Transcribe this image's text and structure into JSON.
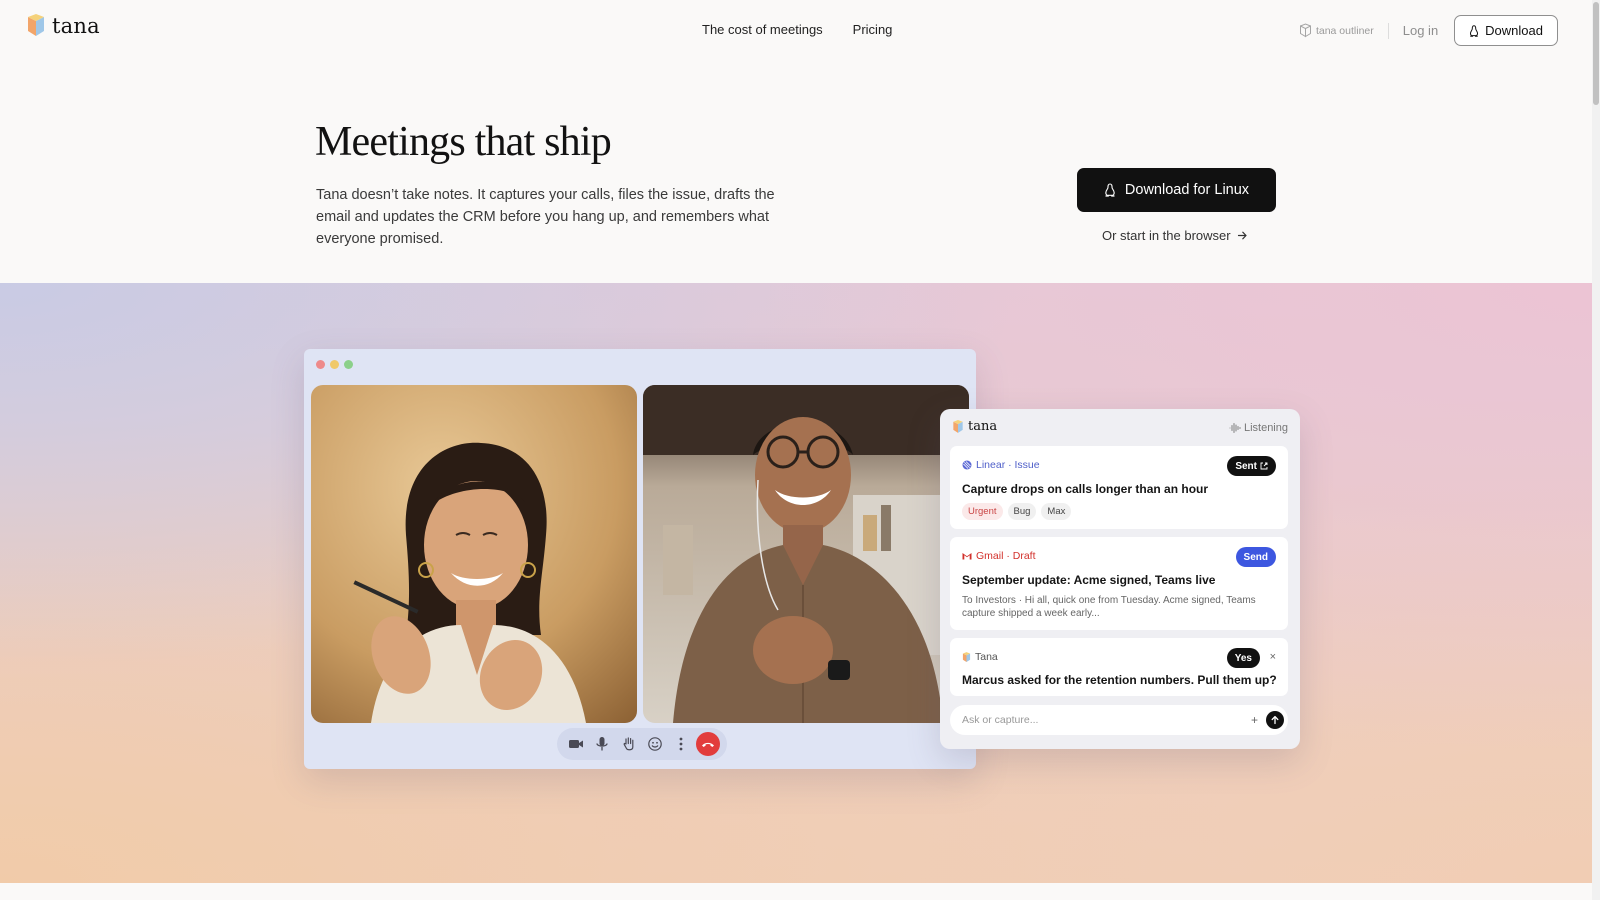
{
  "header": {
    "brand": "tana",
    "nav": [
      {
        "label": "The cost of meetings"
      },
      {
        "label": "Pricing"
      }
    ],
    "outliner_label": "tana outliner",
    "login_label": "Log in",
    "download_label": "Download"
  },
  "hero": {
    "title": "Meetings that ship",
    "subtitle": "Tana doesn’t take notes. It captures your calls, files the issue, drafts the email and updates the CRM before you hang up, and remembers what everyone promised.",
    "cta_label": "Download for Linux",
    "browser_link": "Or start in the browser"
  },
  "panel": {
    "brand": "tana",
    "status": "Listening",
    "cards": [
      {
        "source": "Linear · Issue",
        "action": "Sent",
        "title": "Capture drops on calls longer than an hour",
        "tags": [
          "Urgent",
          "Bug",
          "Max"
        ]
      },
      {
        "source": "Gmail · Draft",
        "action": "Send",
        "title": "September update: Acme signed, Teams live",
        "snippet": "To Investors · Hi all, quick one from Tuesday. Acme signed, Teams capture shipped a week early..."
      },
      {
        "source": "Tana",
        "action": "Yes",
        "close": "×",
        "title": "Marcus asked for the retention numbers. Pull them up?"
      }
    ],
    "ask_placeholder": "Ask or capture...",
    "ask_plus": "+"
  },
  "colors": {
    "brand_dark": "#111111",
    "linear": "#4f5fc9",
    "gmail": "#d2302b",
    "send_blue": "#3d57e0",
    "hangup_red": "#e23c3c",
    "urgent": "#c94646"
  },
  "icons": [
    "tana-logo-icon",
    "linux-icon",
    "arrow-right-icon",
    "camera-icon",
    "microphone-icon",
    "raise-hand-icon",
    "emoji-icon",
    "more-vertical-icon",
    "hang-up-icon",
    "waveform-icon",
    "external-link-icon",
    "send-arrow-icon"
  ]
}
